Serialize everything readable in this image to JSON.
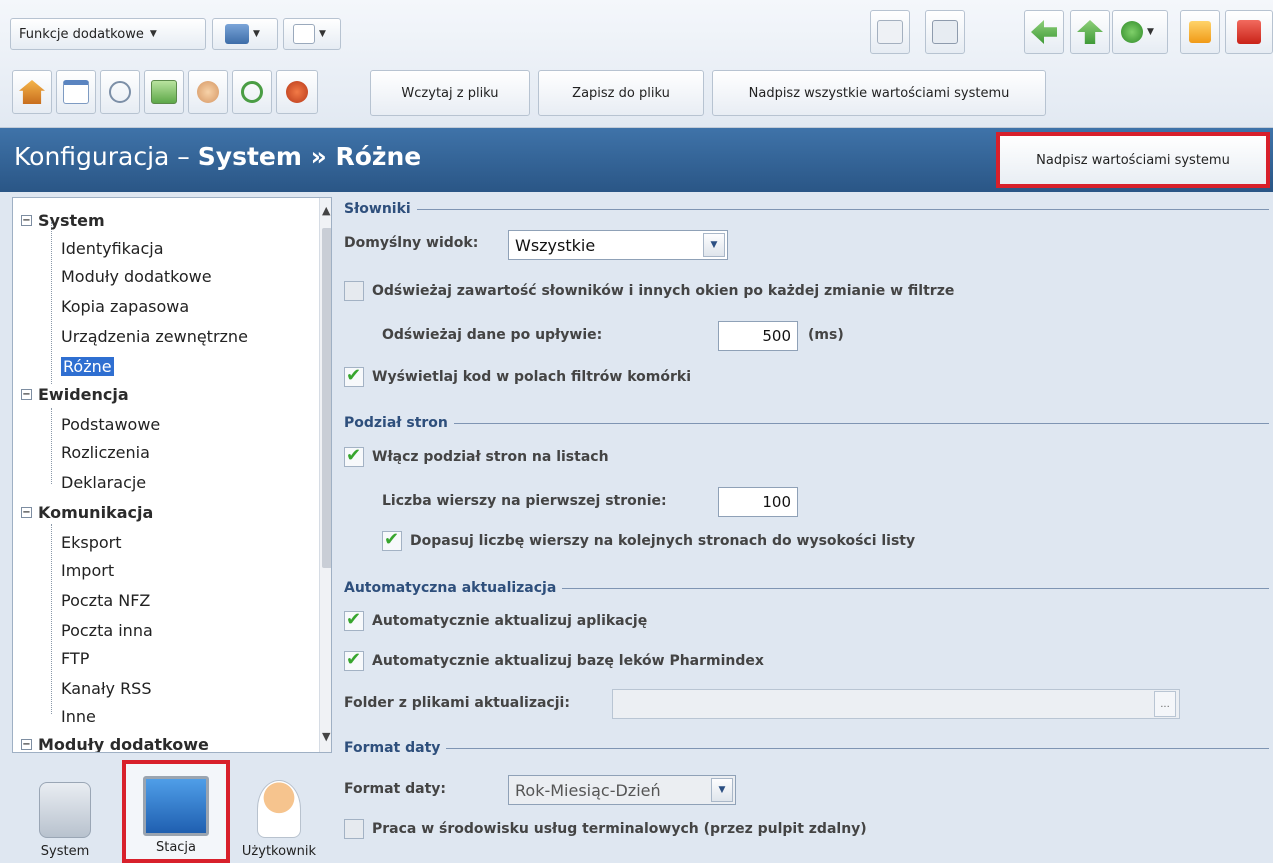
{
  "toolbar": {
    "functions_label": "Funkcje dodatkowe",
    "load_label": "Wczytaj z pliku",
    "save_label": "Zapisz do pliku",
    "override_all_label": "Nadpisz wszystkie wartościami systemu"
  },
  "header": {
    "title_prefix": "Konfiguracja – ",
    "title_bold": "System",
    "title_sep": " » ",
    "title_section": "Różne",
    "override_label": "Nadpisz wartościami systemu"
  },
  "tree": {
    "system": {
      "label": "System",
      "children": [
        "Identyfikacja",
        "Moduły dodatkowe",
        "Kopia zapasowa",
        "Urządzenia zewnętrzne",
        "Różne"
      ]
    },
    "ewidencja": {
      "label": "Ewidencja",
      "children": [
        "Podstawowe",
        "Rozliczenia",
        "Deklaracje"
      ]
    },
    "komunikacja": {
      "label": "Komunikacja",
      "children": [
        "Eksport",
        "Import",
        "Poczta NFZ",
        "Poczta inna",
        "FTP",
        "Kanały RSS",
        "Inne"
      ]
    },
    "moduly": {
      "label": "Moduły dodatkowe"
    },
    "selected": "Różne"
  },
  "modes": {
    "system": "System",
    "stacja": "Stacja",
    "uzytkownik": "Użytkownik"
  },
  "slowniki": {
    "title": "Słowniki",
    "default_view_label": "Domyślny widok:",
    "default_view_value": "Wszystkie",
    "refresh_label": "Odświeżaj zawartość słowników i innych okien po każdej zmianie w filtrze",
    "refresh_checked": false,
    "refresh_after_label": "Odświeżaj dane po upływie:",
    "refresh_after_value": "500",
    "refresh_after_unit": "(ms)",
    "show_code_label": "Wyświetlaj kod w polach filtrów komórki",
    "show_code_checked": true
  },
  "podzial": {
    "title": "Podział stron",
    "enable_label": "Włącz podział stron na listach",
    "enable_checked": true,
    "rows_first_label": "Liczba wierszy na pierwszej stronie:",
    "rows_first_value": "100",
    "fit_label": "Dopasuj liczbę wierszy na kolejnych stronach do wysokości listy",
    "fit_checked": true
  },
  "aktualizacja": {
    "title": "Automatyczna aktualizacja",
    "app_label": "Automatycznie aktualizuj aplikację",
    "app_checked": true,
    "pharm_label": "Automatycznie aktualizuj bazę leków Pharmindex",
    "pharm_checked": true,
    "folder_label": "Folder z plikami aktualizacji:",
    "folder_value": "",
    "browse_label": "..."
  },
  "format": {
    "title": "Format daty",
    "date_label": "Format daty:",
    "date_value": "Rok-Miesiąc-Dzień",
    "terminal_label": "Praca w środowisku usług terminalowych (przez pulpit zdalny)",
    "terminal_checked": false
  },
  "colors": {
    "title_bar": "#2f5f94",
    "highlight": "#d8202b",
    "selection": "#2f6fd1",
    "check": "#37a52e"
  }
}
